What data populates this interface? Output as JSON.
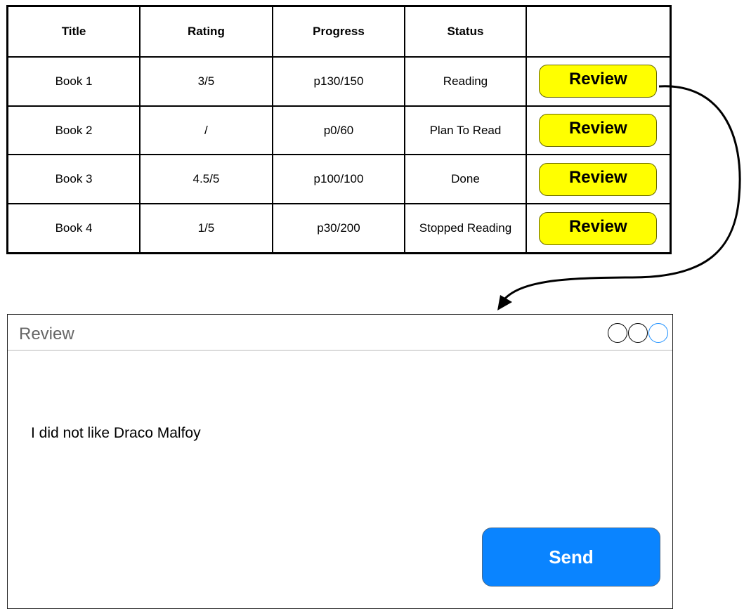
{
  "table": {
    "headers": [
      "Title",
      "Rating",
      "Progress",
      "Status",
      ""
    ],
    "rows": [
      {
        "title": "Book 1",
        "rating": "3/5",
        "progress": "p130/150",
        "status": "Reading",
        "action_label": "Review"
      },
      {
        "title": "Book 2",
        "rating": "/",
        "progress": "p0/60",
        "status": "Plan To Read",
        "action_label": "Review"
      },
      {
        "title": "Book 3",
        "rating": "4.5/5",
        "progress": "p100/100",
        "status": "Done",
        "action_label": "Review"
      },
      {
        "title": "Book 4",
        "rating": "1/5",
        "progress": "p30/200",
        "status": "Stopped Reading",
        "action_label": "Review"
      }
    ]
  },
  "review_window": {
    "title": "Review",
    "body_text": "I did not like Draco Malfoy",
    "send_label": "Send",
    "controls": [
      "circle-icon",
      "circle-icon",
      "circle-icon"
    ]
  },
  "colors": {
    "review_button": "#ffff00",
    "send_button": "#0a84ff",
    "active_control": "#1e90ff"
  }
}
